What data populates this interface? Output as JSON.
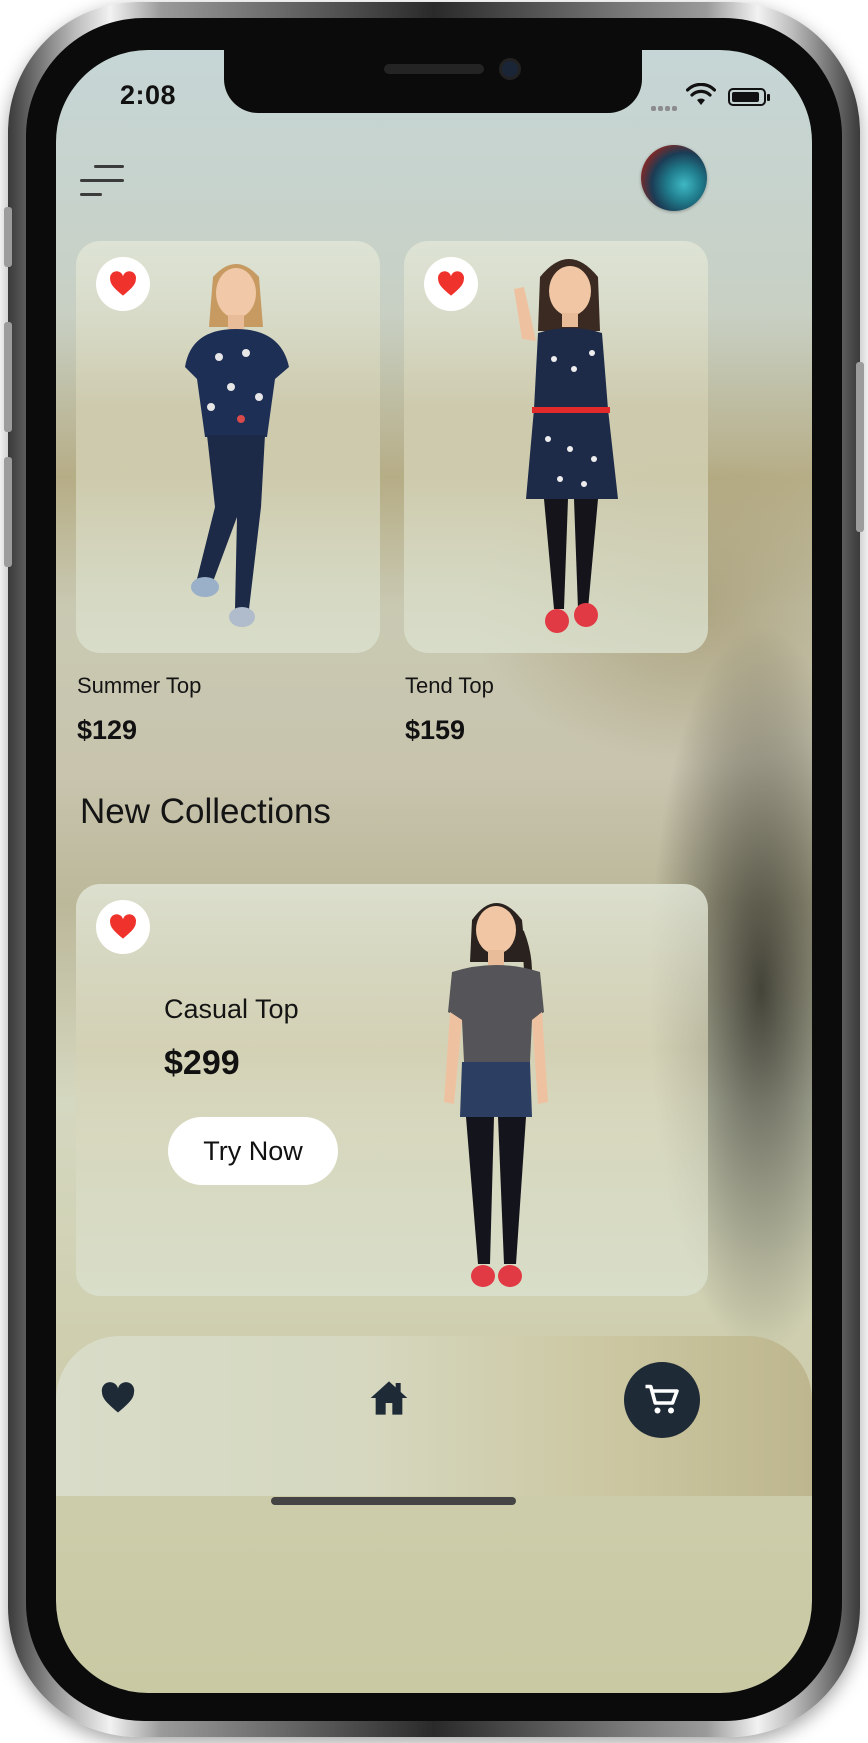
{
  "status_bar": {
    "time": "2:08"
  },
  "products": [
    {
      "name": "Summer Top",
      "price": "$129"
    },
    {
      "name": "Tend Top",
      "price": "$159"
    }
  ],
  "section_title": "New Collections",
  "featured": {
    "name": "Casual Top",
    "price": "$299",
    "button_label": "Try Now"
  },
  "icons": {
    "menu": "menu-icon",
    "favorite": "heart-icon",
    "home": "home-icon",
    "cart": "cart-icon"
  },
  "colors": {
    "heart": "#f0322d",
    "nav_dark": "#1e2a36"
  }
}
